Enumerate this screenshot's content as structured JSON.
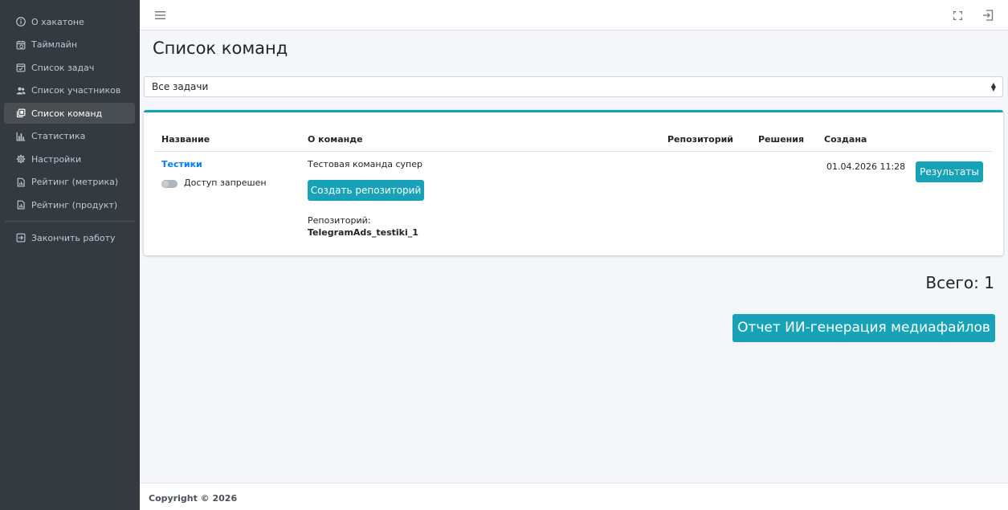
{
  "sidebar": {
    "items": [
      {
        "label": "О хакатоне",
        "icon": "info-icon"
      },
      {
        "label": "Таймлайн",
        "icon": "calendar-clock-icon"
      },
      {
        "label": "Список задач",
        "icon": "calendar-check-icon"
      },
      {
        "label": "Список участников",
        "icon": "users-icon"
      },
      {
        "label": "Список команд",
        "icon": "clone-icon"
      },
      {
        "label": "Статистика",
        "icon": "bar-chart-icon"
      },
      {
        "label": "Настройки",
        "icon": "gear-icon"
      },
      {
        "label": "Рейтинг (метрика)",
        "icon": "file-chart-icon"
      },
      {
        "label": "Рейтинг (продукт)",
        "icon": "file-chart-icon"
      }
    ],
    "active_index": 4,
    "logout_label": "Закончить работу"
  },
  "page": {
    "title": "Список команд",
    "filter_value": "Все задачи",
    "total_label": "Всего: 1",
    "report_button": "Отчет ИИ-генерация медиафайлов"
  },
  "table": {
    "columns": [
      "Название",
      "О команде",
      "Репозиторий",
      "Решения",
      "Создана"
    ],
    "rows": [
      {
        "name": "Тестики",
        "access_label": "Доступ запрешен",
        "access_enabled": false,
        "about": "Тестовая команда супер",
        "create_repo_button": "Создать репозиторий",
        "repo_label": "Репозиторий:",
        "repo_name": "TelegramAds_testiki_1",
        "created": "01.04.2026 11:28",
        "results_button": "Результаты"
      }
    ]
  },
  "footer": {
    "copyright": "Copyright © 2026"
  },
  "colors": {
    "sidebar_bg": "#343a40",
    "accent": "#17a2b8",
    "link": "#007bff"
  }
}
